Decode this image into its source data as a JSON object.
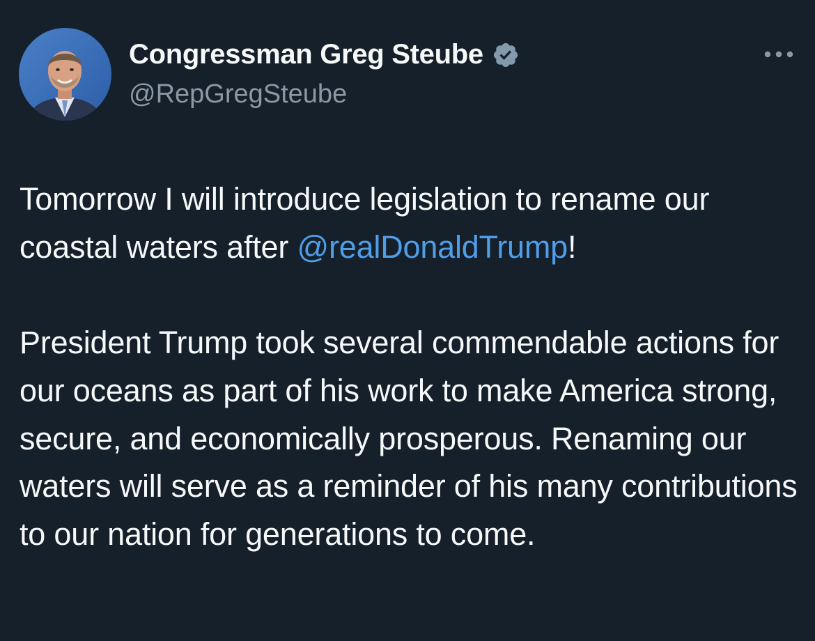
{
  "author": {
    "display_name": "Congressman Greg Steube",
    "handle": "@RepGregSteube",
    "verified_icon": "verified-badge-icon",
    "avatar": "profile-photo"
  },
  "menu": {
    "icon": "more-horizontal-icon"
  },
  "tweet": {
    "p1_before": "Tomorrow I will introduce legislation to rename our coastal waters after ",
    "mention": "@realDonaldTrump",
    "p1_after": "!",
    "p2": "President Trump took several commendable actions for our oceans as part of his work to make America strong, secure, and economically prosperous. Renaming our waters will serve as a reminder of his many contributions to our nation for generations to come."
  },
  "colors": {
    "background": "#15202b",
    "text_primary": "#f7f9f9",
    "text_secondary": "#8b98a5",
    "link": "#4f9ee8",
    "verified_badge": "#829aab"
  }
}
